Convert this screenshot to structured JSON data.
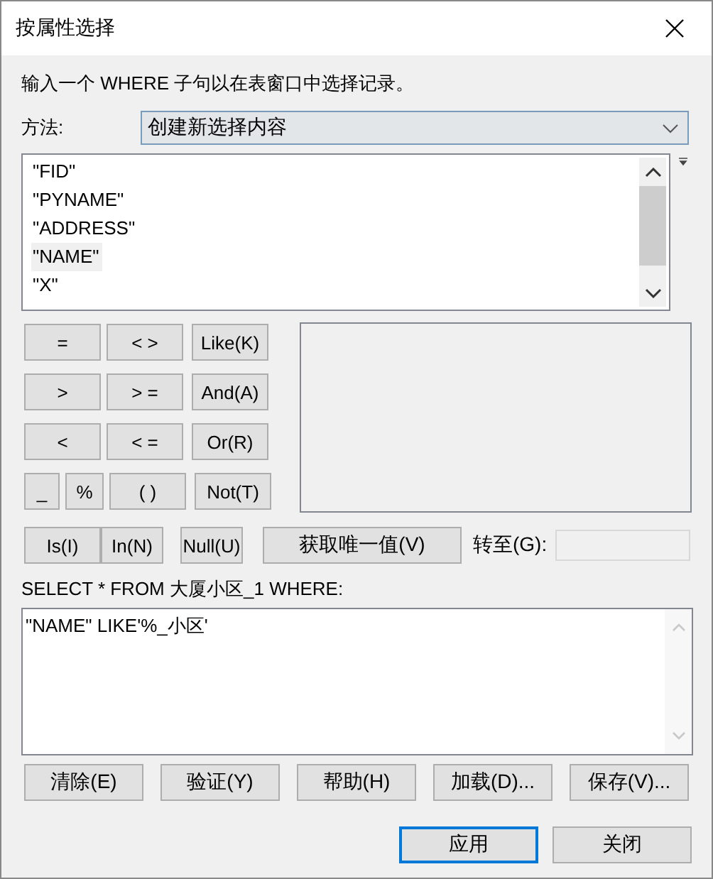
{
  "window": {
    "title": "按属性选择"
  },
  "instruction": "输入一个 WHERE 子句以在表窗口中选择记录。",
  "method": {
    "label": "方法:",
    "value": "创建新选择内容"
  },
  "fields": [
    {
      "name": "\"FID\"",
      "selected": false
    },
    {
      "name": "\"PYNAME\"",
      "selected": false
    },
    {
      "name": "\"ADDRESS\"",
      "selected": false
    },
    {
      "name": "\"NAME\"",
      "selected": true
    },
    {
      "name": "\"X\"",
      "selected": false
    }
  ],
  "operator_rows": [
    [
      {
        "label": "=",
        "kind": "normal"
      },
      {
        "label": "< >",
        "kind": "normal"
      },
      {
        "label": "Like(K)",
        "kind": "normal"
      }
    ],
    [
      {
        "label": ">",
        "kind": "normal"
      },
      {
        "label": "> =",
        "kind": "normal"
      },
      {
        "label": "And(A)",
        "kind": "normal"
      }
    ],
    [
      {
        "label": "<",
        "kind": "normal"
      },
      {
        "label": "< =",
        "kind": "normal"
      },
      {
        "label": "Or(R)",
        "kind": "normal"
      }
    ],
    [
      {
        "label": "_",
        "kind": "small"
      },
      {
        "label": "%",
        "kind": "small"
      },
      {
        "label": "( )",
        "kind": "normal"
      },
      {
        "label": "Not(T)",
        "kind": "normal"
      }
    ]
  ],
  "null_buttons": [
    "Is(I)",
    "In(N)",
    "Null(U)"
  ],
  "unique_values_button": "获取唯一值(V)",
  "goto": {
    "label": "转至(G):"
  },
  "query_label": "SELECT * FROM 大厦小区_1 WHERE:",
  "expression": "\"NAME\" LIKE'%_小区'",
  "buttons": [
    "清除(E)",
    "验证(Y)",
    "帮助(H)",
    "加载(D)...",
    "保存(V)..."
  ],
  "dialog_buttons": [
    {
      "label": "应用",
      "default": true
    },
    {
      "label": "关闭",
      "default": false
    }
  ]
}
